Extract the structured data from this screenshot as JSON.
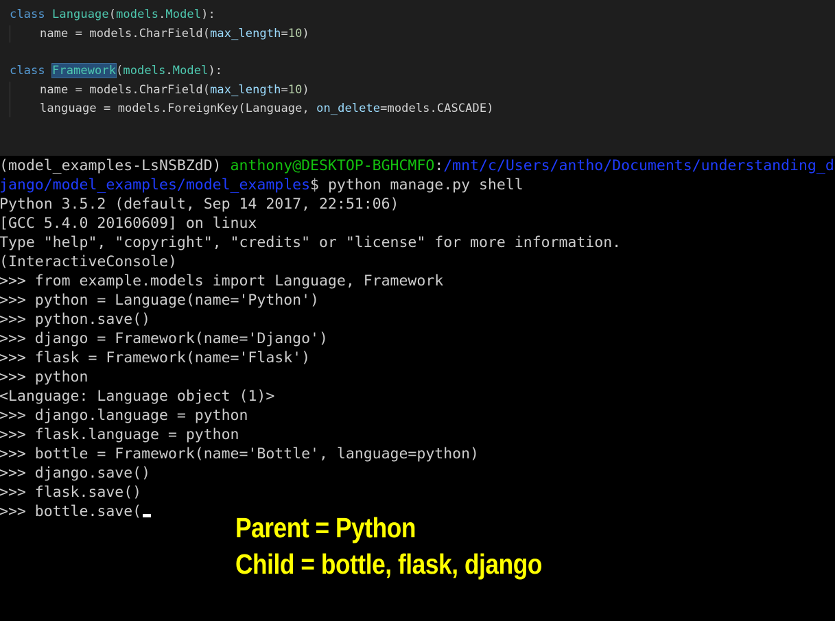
{
  "editor": {
    "lines": [
      {
        "kw": "class",
        "cls_name": "Language",
        "paren_open": "(",
        "base_mod": "models",
        "dot": ".",
        "base_cls": "Model",
        "tail": "):"
      },
      {
        "field": "name",
        "eq": " = ",
        "obj": "models",
        "dot": ".",
        "func": "CharField",
        "open": "(",
        "param": "max_length",
        "assign": "=",
        "num": "10",
        "close": ")"
      },
      {
        "kw": "class",
        "cls_name": "Framework",
        "paren_open": "(",
        "base_mod": "models",
        "dot": ".",
        "base_cls": "Model",
        "tail": "):"
      },
      {
        "field": "name",
        "eq": " = ",
        "obj": "models",
        "dot": ".",
        "func": "CharField",
        "open": "(",
        "param": "max_length",
        "assign": "=",
        "num": "10",
        "close": ")"
      },
      {
        "field": "language",
        "eq": " = ",
        "obj": "models",
        "dot": ".",
        "func": "ForeignKey",
        "open": "(",
        "arg1": "Language",
        "comma": ", ",
        "param": "on_delete",
        "assign": "=",
        "val": "models.CASCADE",
        "close": ")"
      }
    ]
  },
  "terminal": {
    "prompt_env": "(model_examples-LsNSBZdD) ",
    "prompt_user": "anthony@DESKTOP-BGHCMFO",
    "prompt_colon": ":",
    "prompt_path_1": "/mnt/c/Users/antho/Documents/understanding_d",
    "prompt_path_2": "jango/model_examples/model_examples",
    "prompt_dollar": "$ ",
    "command": "python manage.py shell",
    "output": [
      "Python 3.5.2 (default, Sep 14 2017, 22:51:06)",
      "[GCC 5.4.0 20160609] on linux",
      "Type \"help\", \"copyright\", \"credits\" or \"license\" for more information.",
      "(InteractiveConsole)"
    ],
    "session": [
      ">>> from example.models import Language, Framework",
      ">>> python = Language(name='Python')",
      ">>> python.save()",
      ">>> django = Framework(name='Django')",
      ">>> flask = Framework(name='Flask')",
      ">>> python",
      "<Language: Language object (1)>",
      ">>> django.language = python",
      ">>> flask.language = python",
      ">>> bottle = Framework(name='Bottle', language=python)",
      ">>> django.save()",
      ">>> flask.save()",
      ">>> bottle.save("
    ]
  },
  "caption": {
    "line1": "Parent = Python",
    "line2": "Child = bottle, flask, django"
  },
  "colors": {
    "editor_bg": "#1e1e1e",
    "keyword": "#569cd6",
    "class_name": "#4ec9b0",
    "param": "#9cdcfe",
    "number": "#b5cea8",
    "terminal_bg": "#000000",
    "prompt_user": "#13c10e",
    "prompt_path": "#1f3cff",
    "caption": "#ffff00"
  }
}
